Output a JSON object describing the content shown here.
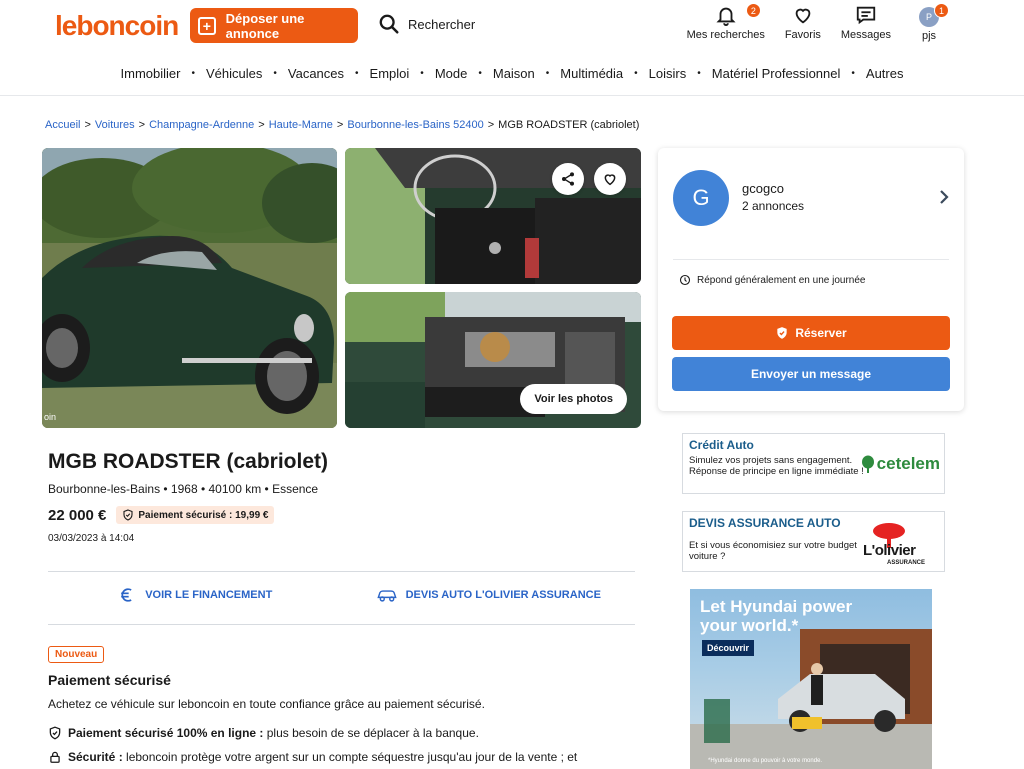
{
  "header": {
    "logo": "leboncoin",
    "post_label": "Déposer une annonce",
    "search_label": "Rechercher",
    "icons": [
      {
        "label": "Mes recherches",
        "badge": "2"
      },
      {
        "label": "Favoris"
      },
      {
        "label": "Messages"
      },
      {
        "label": "pjs",
        "avatar": "P",
        "badge": "1"
      }
    ]
  },
  "categories": [
    "Immobilier",
    "Véhicules",
    "Vacances",
    "Emploi",
    "Mode",
    "Maison",
    "Multimédia",
    "Loisirs",
    "Matériel Professionnel",
    "Autres"
  ],
  "breadcrumb": {
    "links": [
      "Accueil",
      "Voitures",
      "Champagne-Ardenne",
      "Haute-Marne",
      "Bourbonne-les-Bains 52400"
    ],
    "current": "MGB ROADSTER (cabriolet)"
  },
  "photos": {
    "see_photos_label": "Voir les photos",
    "watermark": "oin"
  },
  "listing": {
    "title": "MGB ROADSTER (cabriolet)",
    "subtitle": "Bourbonne-les-Bains • 1968 • 40100 km • Essence",
    "price": "22 000 €",
    "secure_payment": "Paiement sécurisé : 19,99 €",
    "date": "03/03/2023 à 14:04",
    "financing_link": "VOIR LE FINANCEMENT",
    "insurance_link": "DEVIS AUTO L'OLIVIER ASSURANCE"
  },
  "secure_section": {
    "new_tag": "Nouveau",
    "title": "Paiement sécurisé",
    "text": "Achetez ce véhicule sur leboncoin en toute confiance grâce au paiement sécurisé.",
    "bullet1_bold": "Paiement sécurisé 100% en ligne :",
    "bullet1_text": " plus besoin de se déplacer à la banque.",
    "bullet2_bold": "Sécurité :",
    "bullet2_text": " leboncoin protège votre argent sur un compte séquestre jusqu'au jour de la vente ; et"
  },
  "seller": {
    "initial": "G",
    "name": "gcogco",
    "ads_count": "2 annonces",
    "response": "Répond généralement en une journée",
    "reserve_label": "Réserver",
    "message_label": "Envoyer un message"
  },
  "promos": {
    "credit": {
      "title": "Crédit Auto",
      "text": "Simulez vos projets sans engagement. Réponse de principe en ligne immédiate !",
      "brand": "cetelem"
    },
    "insurance": {
      "title": "DEVIS ASSURANCE AUTO",
      "text": "Et si vous économisiez sur votre budget voiture ?",
      "brand": "L'olivier",
      "brand_sub": "ASSURANCE"
    }
  },
  "ad": {
    "title_line1": "Let Hyundai power",
    "title_line2": "your world.*",
    "cta": "Découvrir",
    "footnote": "*Hyundai donne du pouvoir à votre monde."
  },
  "colors": {
    "brand": "#ec5a13",
    "link": "#2a64c7",
    "message_button": "#4183d7"
  }
}
